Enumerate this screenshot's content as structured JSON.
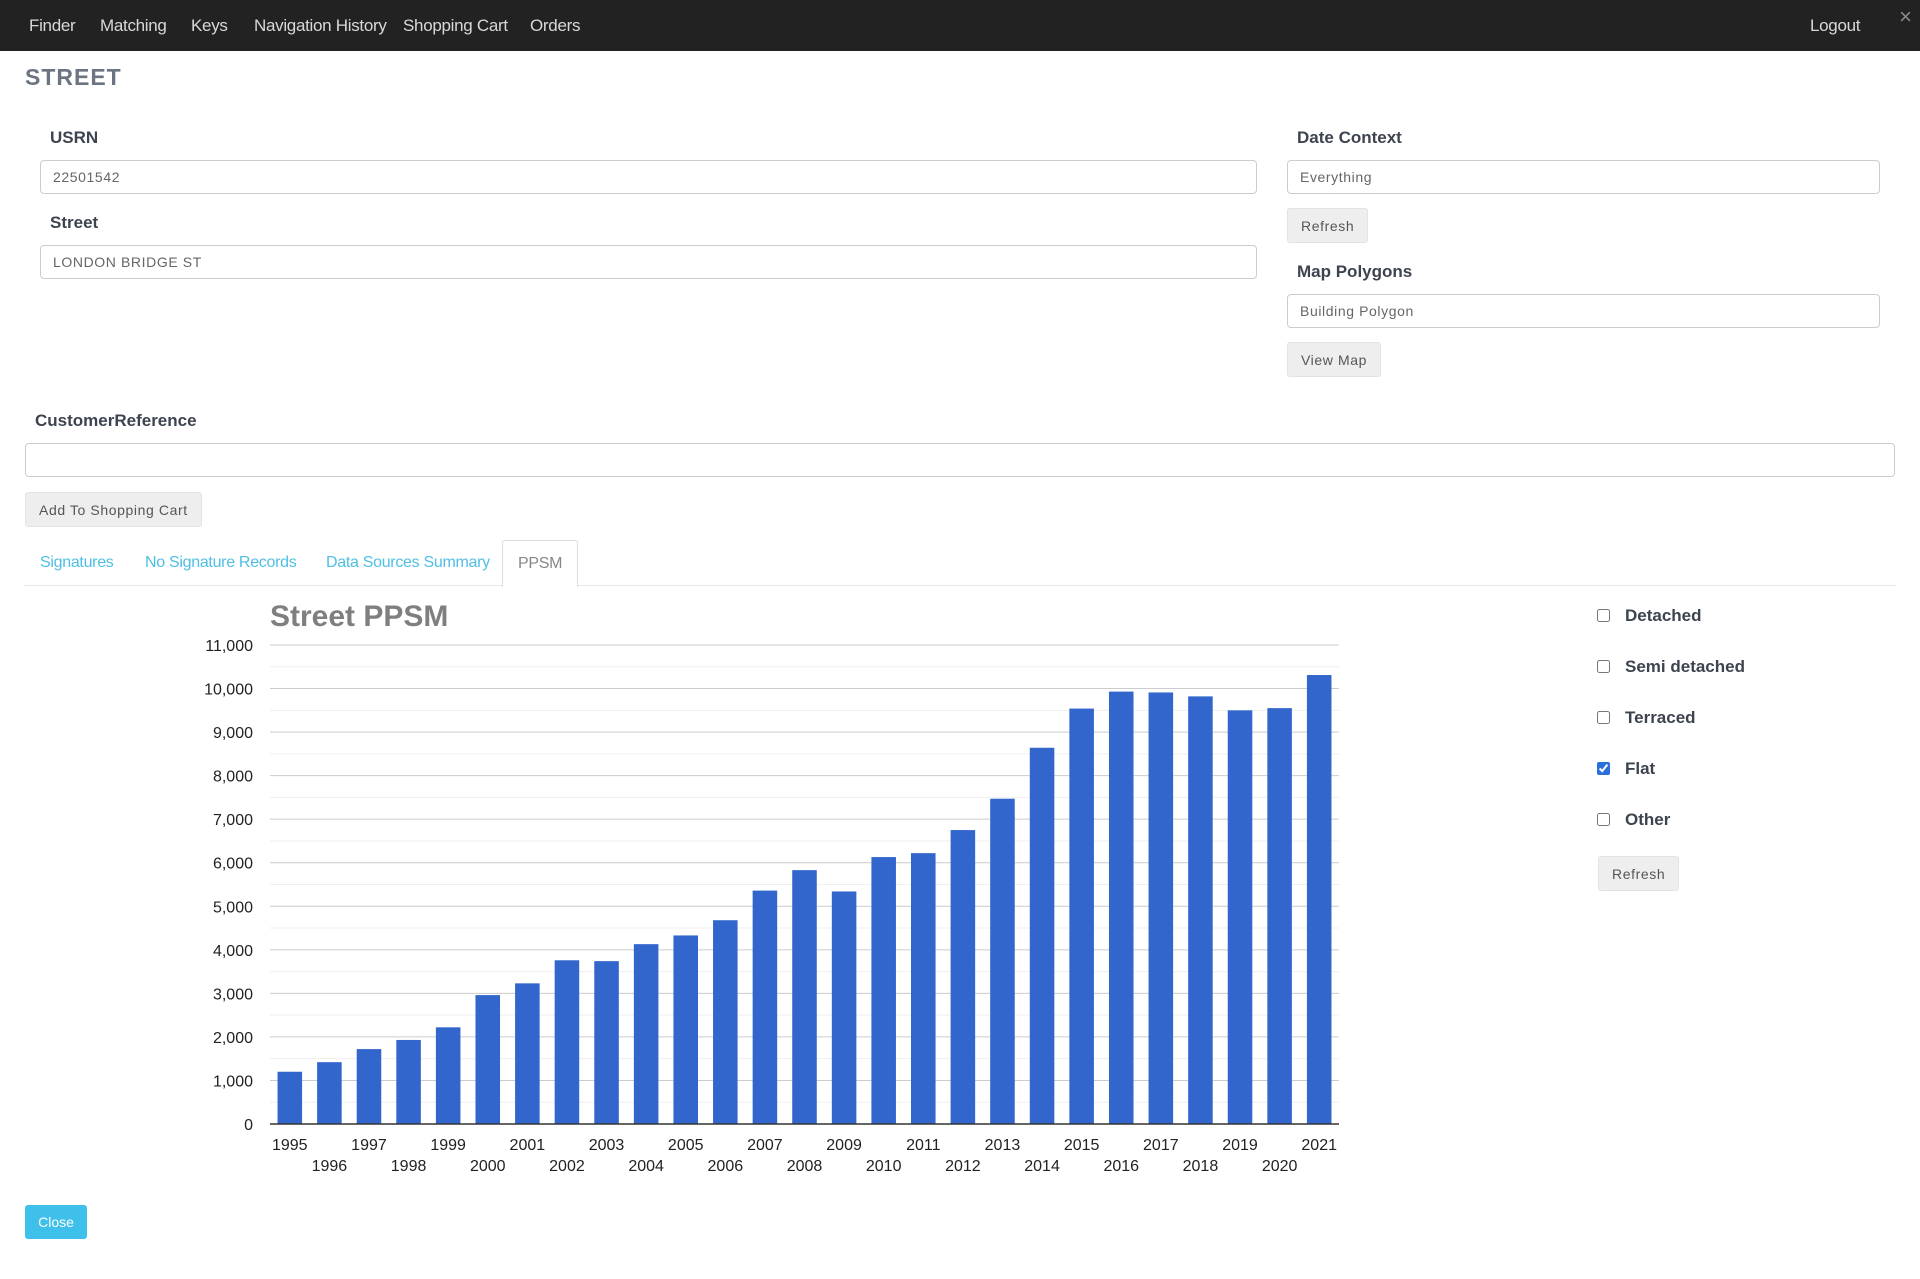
{
  "nav": {
    "items": [
      "Finder",
      "Matching",
      "Keys",
      "Navigation History",
      "Shopping Cart",
      "Orders"
    ],
    "logout": "Logout",
    "close_glyph": "×"
  },
  "page": {
    "title": "STREET"
  },
  "form": {
    "usrn_label": "USRN",
    "usrn_value": "22501542",
    "street_label": "Street",
    "street_value": "LONDON BRIDGE ST",
    "date_context_label": "Date Context",
    "date_context_value": "Everything",
    "refresh_label": "Refresh",
    "map_polygons_label": "Map Polygons",
    "map_polygons_value": "Building Polygon",
    "view_map_label": "View Map",
    "customer_reference_label": "CustomerReference",
    "customer_reference_value": "",
    "add_to_cart_label": "Add To Shopping Cart"
  },
  "tabs": [
    {
      "label": "Signatures",
      "active": false
    },
    {
      "label": "No Signature Records",
      "active": false
    },
    {
      "label": "Data Sources Summary",
      "active": false
    },
    {
      "label": "PPSM",
      "active": true
    }
  ],
  "filters": {
    "items": [
      {
        "label": "Detached",
        "checked": false
      },
      {
        "label": "Semi detached",
        "checked": false
      },
      {
        "label": "Terraced",
        "checked": false
      },
      {
        "label": "Flat",
        "checked": true
      },
      {
        "label": "Other",
        "checked": false
      }
    ],
    "refresh_label": "Refresh"
  },
  "close_label": "Close",
  "colors": {
    "bar": "#3366cc",
    "navbar": "#222222",
    "tab_link": "#4fbfe4",
    "close_button": "#3ec0ea"
  },
  "chart_data": {
    "type": "bar",
    "title": "Street PPSM",
    "xlabel": "",
    "ylabel": "",
    "categories": [
      "1995",
      "1996",
      "1997",
      "1998",
      "1999",
      "2000",
      "2001",
      "2002",
      "2003",
      "2004",
      "2005",
      "2006",
      "2007",
      "2008",
      "2009",
      "2010",
      "2011",
      "2012",
      "2013",
      "2014",
      "2015",
      "2016",
      "2017",
      "2018",
      "2019",
      "2020",
      "2021"
    ],
    "values": [
      1200,
      1420,
      1720,
      1930,
      2220,
      2960,
      3230,
      3760,
      3740,
      4130,
      4330,
      4680,
      5360,
      5830,
      5340,
      6130,
      6220,
      6750,
      7470,
      8640,
      9540,
      9930,
      9910,
      9820,
      9500,
      9550,
      10310
    ],
    "ylim": [
      0,
      11000
    ],
    "yticks": [
      0,
      1000,
      2000,
      3000,
      4000,
      5000,
      6000,
      7000,
      8000,
      9000,
      10000,
      11000
    ],
    "ytick_labels": [
      "0",
      "1,000",
      "2,000",
      "3,000",
      "4,000",
      "5,000",
      "6,000",
      "7,000",
      "8,000",
      "9,000",
      "10,000",
      "11,000"
    ],
    "grid": true,
    "legend": "none"
  }
}
